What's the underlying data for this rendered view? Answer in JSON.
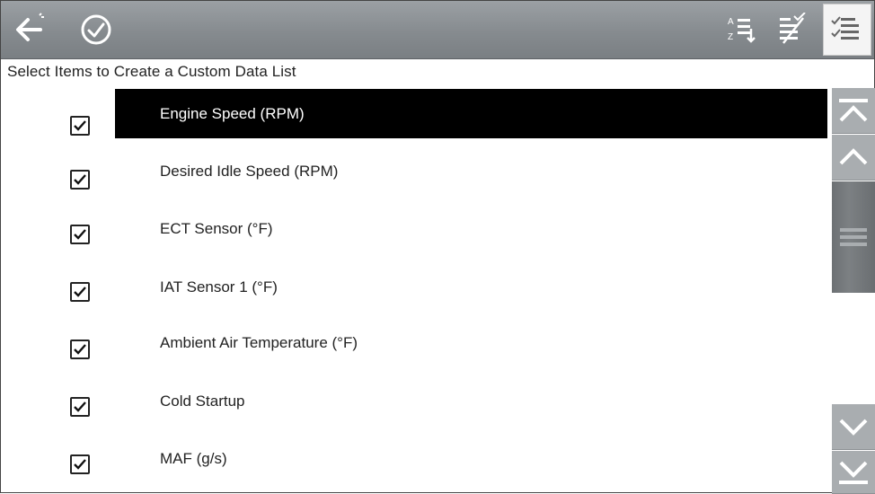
{
  "toolbar": {
    "back_icon": "back-arrow-icon",
    "done_icon": "checkmark-circle-icon",
    "sort_icon": "sort-list-icon",
    "clear_icon": "deselect-all-icon",
    "select_all_icon": "select-all-icon"
  },
  "page": {
    "title": "Select Items to Create a Custom Data List"
  },
  "list": {
    "items": [
      {
        "label": "Engine Speed (RPM)",
        "checked": true,
        "selected": true
      },
      {
        "label": "Desired Idle Speed (RPM)",
        "checked": true,
        "selected": false
      },
      {
        "label": "ECT Sensor (°F)",
        "checked": true,
        "selected": false
      },
      {
        "label": "IAT Sensor 1 (°F)",
        "checked": true,
        "selected": false
      },
      {
        "label": "Ambient Air Temperature (°F)",
        "checked": true,
        "selected": false
      },
      {
        "label": "Cold Startup",
        "checked": true,
        "selected": false
      },
      {
        "label": "MAF (g/s)",
        "checked": true,
        "selected": false
      }
    ]
  },
  "colors": {
    "toolbar": "#8b9094",
    "selected_row": "#000000",
    "scroll_buttons": "#a9adb0",
    "scroll_thumb": "#73777a"
  }
}
